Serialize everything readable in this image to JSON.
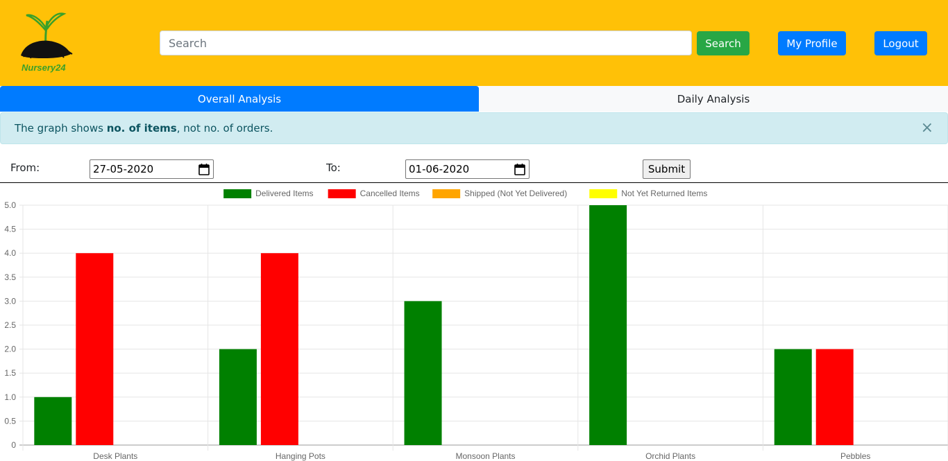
{
  "header": {
    "brand": "Nursery24",
    "search_placeholder": "Search",
    "search_button": "Search",
    "profile_button": "My Profile",
    "logout_button": "Logout"
  },
  "tabs": [
    {
      "label": "Overall Analysis",
      "active": true
    },
    {
      "label": "Daily Analysis",
      "active": false
    }
  ],
  "alert": {
    "prefix": "The graph shows ",
    "bold": "no. of items",
    "suffix": ", not no. of orders.",
    "close": "×"
  },
  "filter": {
    "from_label": "From:",
    "from_value": "27-05-2020",
    "to_label": "To:",
    "to_value": "01-06-2020",
    "submit": "Submit"
  },
  "colors": {
    "header_bg": "#ffc107",
    "tab_active": "#007bff",
    "search_btn": "#28a745",
    "alert_bg": "#d1ecf1"
  },
  "chart_data": {
    "type": "bar",
    "categories": [
      "Desk Plants",
      "Hanging Pots",
      "Monsoon Plants",
      "Orchid Plants",
      "Pebbles"
    ],
    "series": [
      {
        "name": "Delivered Items",
        "color": "#008000",
        "values": [
          1,
          2,
          3,
          5,
          2
        ]
      },
      {
        "name": "Cancelled Items",
        "color": "#ff0000",
        "values": [
          4,
          4,
          0,
          0,
          2
        ]
      },
      {
        "name": "Shipped (Not Yet Delivered)",
        "color": "#ffa500",
        "values": [
          0,
          0,
          0,
          0,
          0
        ]
      },
      {
        "name": "Not Yet Returned Items",
        "color": "#ffff00",
        "values": [
          0,
          0,
          0,
          0,
          0
        ]
      }
    ],
    "ylim": [
      0,
      5
    ],
    "yticks": [
      "0",
      "0.5",
      "1.0",
      "1.5",
      "2.0",
      "2.5",
      "3.0",
      "3.5",
      "4.0",
      "4.5",
      "5.0"
    ],
    "grid": true,
    "legend": "top"
  }
}
